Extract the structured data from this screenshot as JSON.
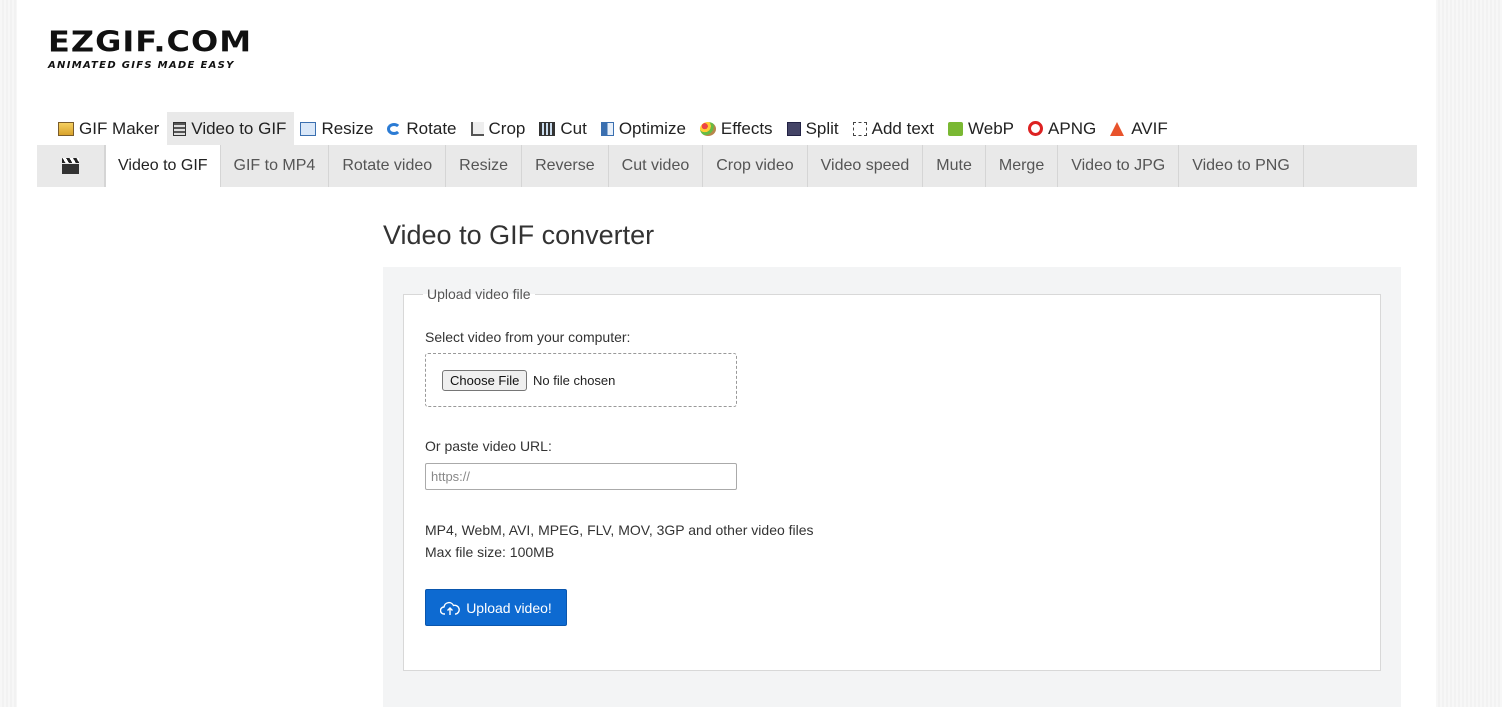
{
  "logo": {
    "title": "EZGIF.COM",
    "tagline": "ANIMATED GIFS MADE EASY"
  },
  "main_nav": [
    {
      "label": "GIF Maker",
      "icon": "gif-maker-icon"
    },
    {
      "label": "Video to GIF",
      "icon": "video-icon",
      "active": true
    },
    {
      "label": "Resize",
      "icon": "resize-icon"
    },
    {
      "label": "Rotate",
      "icon": "rotate-icon"
    },
    {
      "label": "Crop",
      "icon": "crop-icon"
    },
    {
      "label": "Cut",
      "icon": "cut-icon"
    },
    {
      "label": "Optimize",
      "icon": "optimize-icon"
    },
    {
      "label": "Effects",
      "icon": "effects-icon"
    },
    {
      "label": "Split",
      "icon": "split-icon"
    },
    {
      "label": "Add text",
      "icon": "add-text-icon"
    },
    {
      "label": "WebP",
      "icon": "webp-icon"
    },
    {
      "label": "APNG",
      "icon": "apng-icon"
    },
    {
      "label": "AVIF",
      "icon": "avif-icon"
    }
  ],
  "sub_nav": [
    {
      "label": "Video to GIF",
      "active": true
    },
    {
      "label": "GIF to MP4"
    },
    {
      "label": "Rotate video"
    },
    {
      "label": "Resize"
    },
    {
      "label": "Reverse"
    },
    {
      "label": "Cut video"
    },
    {
      "label": "Crop video"
    },
    {
      "label": "Video speed"
    },
    {
      "label": "Mute"
    },
    {
      "label": "Merge"
    },
    {
      "label": "Video to JPG"
    },
    {
      "label": "Video to PNG"
    }
  ],
  "page_title": "Video to GIF converter",
  "upload": {
    "legend": "Upload video file",
    "select_label": "Select video from your computer:",
    "choose_file_label": "Choose File",
    "no_file_text": "No file chosen",
    "url_label": "Or paste video URL:",
    "url_placeholder": "https://",
    "url_value": "",
    "formats_text": "MP4, WebM, AVI, MPEG, FLV, MOV, 3GP and other video files",
    "max_size_text": "Max file size: 100MB",
    "button_label": "Upload video!",
    "button_icon": "cloud-upload-icon",
    "button_color": "#0d6ad1"
  }
}
